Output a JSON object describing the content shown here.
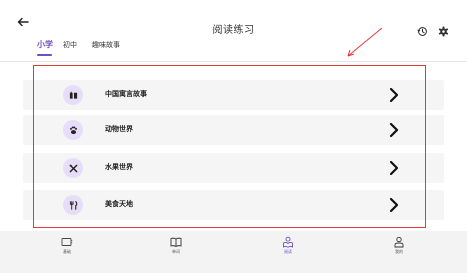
{
  "header": {
    "title": "阅读练习",
    "back_icon": "back-arrow-icon",
    "actions": [
      "history-icon",
      "settings-gear-icon"
    ]
  },
  "tabs": [
    {
      "label": "小学",
      "active": true
    },
    {
      "label": "初中",
      "active": false
    },
    {
      "label": "趣味故事",
      "active": false
    }
  ],
  "categories": [
    {
      "label": "中国寓言故事",
      "icon": "book-icon"
    },
    {
      "label": "动物世界",
      "icon": "paw-icon"
    },
    {
      "label": "水果世界",
      "icon": "fruit-utensils-icon"
    },
    {
      "label": "美食天地",
      "icon": "fork-knife-icon"
    }
  ],
  "bottom_nav": [
    {
      "label": "基础",
      "icon": "card-icon",
      "active": false
    },
    {
      "label": "单词",
      "icon": "open-book-icon",
      "active": false
    },
    {
      "label": "阅读",
      "icon": "reading-icon",
      "active": true
    },
    {
      "label": "我的",
      "icon": "profile-icon",
      "active": false
    }
  ],
  "colors": {
    "accent": "#6d4fc6",
    "icon_circle": "#e6def8",
    "row_background": "#f5f5f5",
    "annotation": "#e53935",
    "nav_background": "#f3f3f3"
  }
}
